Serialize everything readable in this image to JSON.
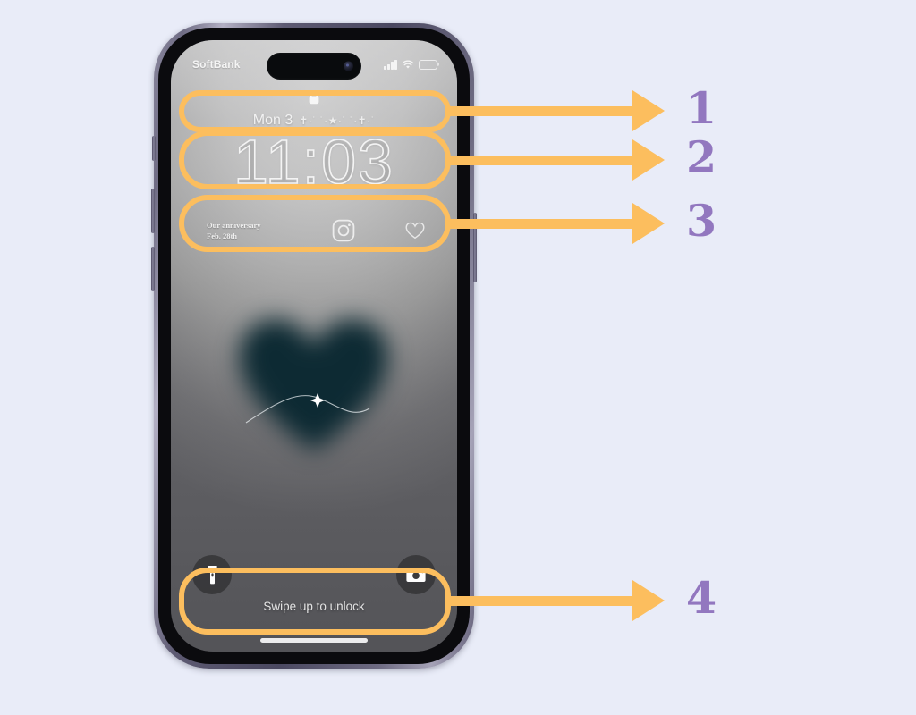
{
  "page": {
    "background_color": "#e9ecf8",
    "accent_highlight_color": "#fcbe5e",
    "number_label_color": "#9277bf"
  },
  "phone": {
    "status_bar": {
      "carrier": "SoftBank",
      "signal_icon": "cellular-signal-icon",
      "wifi_icon": "wifi-icon",
      "battery_icon": "battery-icon",
      "battery_level_percent": 62
    },
    "dynamic_island": {
      "camera_icon": "front-camera-icon"
    },
    "lock_icon": "lock-closed-icon",
    "date_line": {
      "date": "Mon 3",
      "decoration": "✝·˙ ˙·★·˙ ˙·✝·˙"
    },
    "clock": {
      "time": "11:03"
    },
    "widget_row": {
      "anniversary_title": "Our anniversary",
      "anniversary_date": "Feb. 28th",
      "instagram_icon": "instagram-icon",
      "heart_icon": "heart-outline-icon"
    },
    "wallpaper": {
      "art": "blurred-heart-with-shooting-star",
      "heart_color": "#0d2a33"
    },
    "bottom": {
      "flashlight_icon": "flashlight-icon",
      "camera_icon": "camera-icon",
      "swipe_hint": "Swipe up to unlock",
      "home_indicator": "home-indicator-bar"
    },
    "hardware": {
      "silent_switch": "silent-switch-button",
      "volume_up": "volume-up-button",
      "volume_down": "volume-down-button",
      "power": "power-button"
    }
  },
  "annotations": [
    {
      "number": "1",
      "target": "date-line"
    },
    {
      "number": "2",
      "target": "clock"
    },
    {
      "number": "3",
      "target": "widget-row"
    },
    {
      "number": "4",
      "target": "bottom-quick-actions"
    }
  ]
}
